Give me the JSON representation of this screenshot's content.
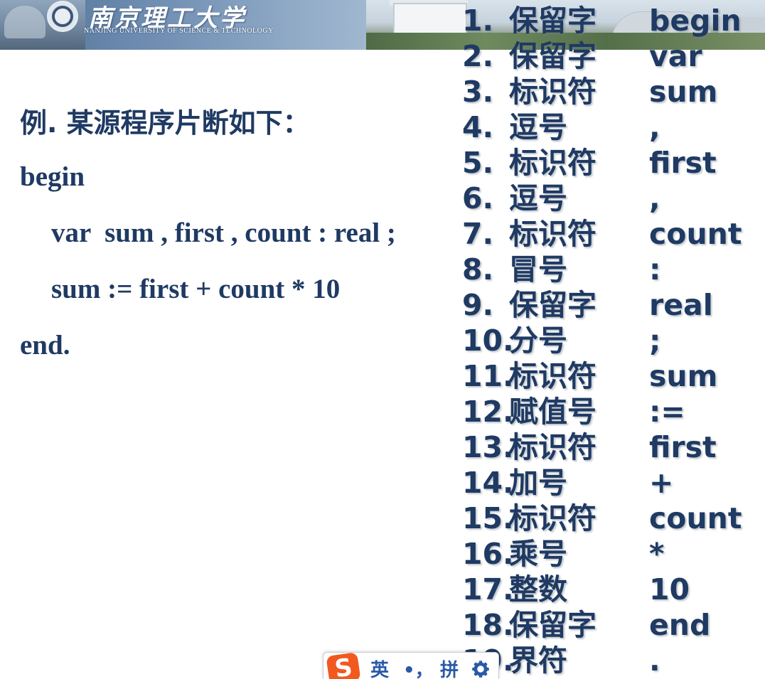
{
  "banner": {
    "school_name_cn": "南京理工大学",
    "school_name_en": "NANJING UNIVERSITY OF SCIENCE & TECHNOLOGY"
  },
  "slide": {
    "heading": "例. 某源程序片断如下：",
    "code_lines": [
      "begin",
      "var  sum , first , count : real ;",
      "sum := first + count * 10",
      "end."
    ]
  },
  "tokens": [
    {
      "num": "1.",
      "type": "保留字",
      "value": "begin"
    },
    {
      "num": "2.",
      "type": "保留字",
      "value": "var"
    },
    {
      "num": "3.",
      "type": "标识符",
      "value": "sum"
    },
    {
      "num": "4.",
      "type": "逗号",
      "value": ","
    },
    {
      "num": "5.",
      "type": "标识符",
      "value": "first"
    },
    {
      "num": "6.",
      "type": "逗号",
      "value": ","
    },
    {
      "num": "7.",
      "type": "标识符",
      "value": "count"
    },
    {
      "num": "8.",
      "type": "冒号",
      "value": ":"
    },
    {
      "num": "9.",
      "type": "保留字",
      "value": "real"
    },
    {
      "num": "10.",
      "type": "分号",
      "value": ";"
    },
    {
      "num": "11.",
      "type": "标识符",
      "value": "sum"
    },
    {
      "num": "12.",
      "type": "赋值号",
      "value": ":="
    },
    {
      "num": "13.",
      "type": "标识符",
      "value": "first"
    },
    {
      "num": "14.",
      "type": "加号",
      "value": "+"
    },
    {
      "num": "15.",
      "type": "标识符",
      "value": "count"
    },
    {
      "num": "16.",
      "type": "乘号",
      "value": "*"
    },
    {
      "num": "17.",
      "type": "整数",
      "value": "10"
    },
    {
      "num": "18.",
      "type": "保留字",
      "value": "end"
    },
    {
      "num": "19.",
      "type": "界符",
      "value": "."
    }
  ],
  "ime_toolbar": {
    "logo": "S",
    "mode": "英",
    "punct": "•，",
    "input": "拼",
    "icons": [
      "sogou-logo-icon",
      "gear-icon"
    ]
  },
  "colors": {
    "text": "#1f3a63",
    "ime_orange": "#f2591f",
    "ime_blue": "#2a5aa7"
  }
}
